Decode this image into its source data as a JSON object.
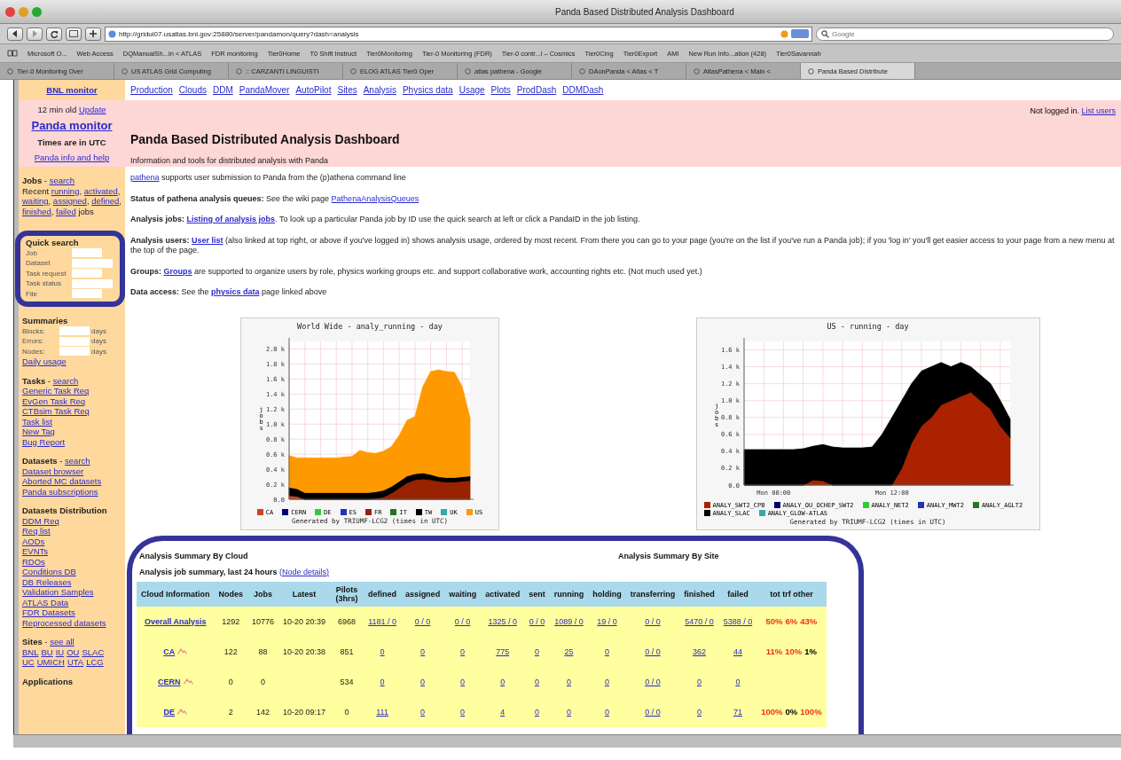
{
  "window": {
    "title": "Panda Based Distributed Analysis Dashboard"
  },
  "toolbar": {
    "url": "http://gridui07.usatlas.bnl.gov:25880/server/pandamon/query?dash=analysis",
    "search_placeholder": "Google"
  },
  "bookmarks": [
    "Microsoft O...",
    "Web Access",
    "DQManualSh...in < ATLAS",
    "FDR monitoring",
    "Tier0Home",
    "T0 Shift Instruct",
    "Tier0Monitoring",
    "Tier-0 Monitoring (FDR)",
    "Tier-0 contr...l – Cosmics",
    "Tier0Cing",
    "Tier0Export",
    "AMI",
    "New Run Info...ation (428)",
    "Tier0Savannah"
  ],
  "tabs": [
    {
      "label": "Tier-0 Monitoring Over",
      "selected": false
    },
    {
      "label": "US ATLAS Grid Computing",
      "selected": false
    },
    {
      "label": ":: CARZANTI LINGUISTI",
      "selected": false
    },
    {
      "label": "ELOG ATLAS Tier0 Oper",
      "selected": false
    },
    {
      "label": "atlas pathena - Google",
      "selected": false
    },
    {
      "label": "DAonPanda < Atlas < T",
      "selected": false
    },
    {
      "label": "AtlasPathena < Main <",
      "selected": false
    },
    {
      "label": "Panda Based Distribute",
      "selected": true
    }
  ],
  "sidebar": {
    "monitor_link": "BNL monitor",
    "banner": [
      [
        {
          "text": "12 min old ",
          "kind": "plain"
        },
        {
          "text": "Update",
          "kind": "link"
        }
      ],
      [
        {
          "text": "Panda monitor",
          "kind": "big-link"
        }
      ],
      [
        {
          "text": "Times are in UTC",
          "kind": "bold"
        }
      ],
      [
        {
          "text": "Panda info and help",
          "kind": "link"
        }
      ]
    ],
    "sections": [
      {
        "kind": "links",
        "lines": [
          [
            {
              "text": "Jobs",
              "kind": "bold"
            },
            {
              "text": " - ",
              "kind": "plain"
            },
            {
              "text": "search",
              "kind": "link"
            }
          ],
          [
            {
              "text": "Recent ",
              "kind": "plain"
            },
            {
              "text": "running",
              "kind": "link"
            },
            {
              "text": ", ",
              "kind": "plain"
            },
            {
              "text": "activated",
              "kind": "link"
            },
            {
              "text": ", ",
              "kind": "plain"
            },
            {
              "text": "waiting",
              "kind": "link"
            },
            {
              "text": ", ",
              "kind": "plain"
            },
            {
              "text": "assigned",
              "kind": "link"
            },
            {
              "text": ", ",
              "kind": "plain"
            },
            {
              "text": "defined",
              "kind": "link"
            },
            {
              "text": ", ",
              "kind": "plain"
            },
            {
              "text": "finished",
              "kind": "link"
            },
            {
              "text": ", ",
              "kind": "plain"
            },
            {
              "text": "failed",
              "kind": "link"
            },
            {
              "text": " jobs",
              "kind": "plain"
            }
          ]
        ]
      },
      {
        "kind": "form",
        "framed": true,
        "heading": "Quick search",
        "fields": [
          {
            "label": "Job"
          },
          {
            "label": "Dataset"
          },
          {
            "label": "Task request"
          },
          {
            "label": "Task status"
          },
          {
            "label": "File"
          }
        ]
      },
      {
        "kind": "form",
        "framed": false,
        "heading": "Summaries",
        "fields": [
          {
            "label": "Blocks:",
            "suffix": "days"
          },
          {
            "label": "Errors:",
            "suffix": "days"
          },
          {
            "label": "Nodes:",
            "suffix": "days"
          }
        ],
        "after": [
          [
            {
              "text": "Daily usage",
              "kind": "link"
            }
          ]
        ]
      },
      {
        "kind": "links",
        "lines": [
          [
            {
              "text": "Tasks",
              "kind": "bold"
            },
            {
              "text": " - ",
              "kind": "plain"
            },
            {
              "text": "search",
              "kind": "link"
            }
          ],
          [
            {
              "text": "Generic Task Req",
              "kind": "link"
            }
          ],
          [
            {
              "text": "EvGen Task Req",
              "kind": "link"
            }
          ],
          [
            {
              "text": "CTBsim Task Req",
              "kind": "link"
            }
          ],
          [
            {
              "text": "Task list",
              "kind": "link"
            }
          ],
          [
            {
              "text": "New Tag",
              "kind": "link"
            }
          ],
          [
            {
              "text": "Bug Report",
              "kind": "link"
            }
          ]
        ]
      },
      {
        "kind": "links",
        "lines": [
          [
            {
              "text": "Datasets",
              "kind": "bold"
            },
            {
              "text": " - ",
              "kind": "plain"
            },
            {
              "text": "search",
              "kind": "link"
            }
          ],
          [
            {
              "text": "Dataset browser",
              "kind": "link"
            }
          ],
          [
            {
              "text": "Aborted MC datasets",
              "kind": "link"
            }
          ],
          [
            {
              "text": "Panda subscriptions",
              "kind": "link"
            }
          ]
        ]
      },
      {
        "kind": "links",
        "lines": [
          [
            {
              "text": "Datasets Distribution",
              "kind": "bold"
            }
          ],
          [
            {
              "text": "DDM Req",
              "kind": "link"
            }
          ],
          [
            {
              "text": "Req list",
              "kind": "link"
            }
          ],
          [
            {
              "text": "AODs",
              "kind": "link"
            }
          ],
          [
            {
              "text": "EVNTs",
              "kind": "link"
            }
          ],
          [
            {
              "text": "RDOs",
              "kind": "link"
            }
          ],
          [
            {
              "text": "Conditions DB",
              "kind": "link"
            }
          ],
          [
            {
              "text": "DB Releases",
              "kind": "link"
            }
          ],
          [
            {
              "text": "Validation Samples",
              "kind": "link"
            }
          ],
          [
            {
              "text": "ATLAS Data",
              "kind": "link"
            }
          ],
          [
            {
              "text": "FDR Datasets",
              "kind": "link"
            }
          ],
          [
            {
              "text": "Reprocessed datasets",
              "kind": "link"
            }
          ]
        ]
      },
      {
        "kind": "links",
        "lines": [
          [
            {
              "text": "Sites",
              "kind": "bold"
            },
            {
              "text": " - ",
              "kind": "plain"
            },
            {
              "text": "see all",
              "kind": "link"
            }
          ],
          [
            {
              "text": "BNL",
              "kind": "link"
            },
            {
              "text": "BU",
              "kind": "link"
            },
            {
              "text": "IU",
              "kind": "link"
            },
            {
              "text": "OU",
              "kind": "link"
            },
            {
              "text": "SLAC",
              "kind": "link"
            }
          ],
          [
            {
              "text": "UC",
              "kind": "link"
            },
            {
              "text": "UMICH",
              "kind": "link"
            },
            {
              "text": "UTA",
              "kind": "link"
            },
            {
              "text": "LCG",
              "kind": "link"
            }
          ]
        ]
      },
      {
        "kind": "links",
        "lines": [
          [
            {
              "text": "Applications",
              "kind": "bold"
            }
          ]
        ]
      }
    ]
  },
  "nav": [
    "Production",
    "Clouds",
    "DDM",
    "PandaMover",
    "AutoPilot",
    "Sites",
    "Analysis",
    "Physics data",
    "Usage",
    "Plots",
    "ProdDash",
    "DDMDash"
  ],
  "header": {
    "login": [
      {
        "text": "Not logged in. ",
        "kind": "plain"
      },
      {
        "text": "List users",
        "kind": "link"
      }
    ],
    "title": "Panda Based Distributed Analysis Dashboard",
    "subtitle": "Information and tools for distributed analysis with Panda"
  },
  "paragraphs": [
    [
      {
        "text": "pathena",
        "kind": "link"
      },
      {
        "text": " supports user submission to Panda from the (p)athena command line",
        "kind": "plain"
      }
    ],
    [
      {
        "text": "Status of pathena analysis queues:",
        "kind": "bold"
      },
      {
        "text": " See the wiki page ",
        "kind": "plain"
      },
      {
        "text": "PathenaAnalysisQueues",
        "kind": "link"
      }
    ],
    [
      {
        "text": "Analysis jobs: ",
        "kind": "bold"
      },
      {
        "text": "Listing of analysis jobs",
        "kind": "bold-link"
      },
      {
        "text": ". To look up a particular Panda job by ID use the quick search at left or click a PandaID in the job listing.",
        "kind": "plain"
      }
    ],
    [
      {
        "text": "Analysis users: ",
        "kind": "bold"
      },
      {
        "text": "User list",
        "kind": "bold-link"
      },
      {
        "text": " (also linked at top right, or above if you've logged in) shows analysis usage, ordered by most recent. From there you can go to your page (you're on the list if you've run a Panda job); if you 'log in' you'll get easier access to your page from a new menu at the top of the page.",
        "kind": "plain"
      }
    ],
    [
      {
        "text": "Groups: ",
        "kind": "bold"
      },
      {
        "text": "Groups",
        "kind": "bold-link"
      },
      {
        "text": " are supported to organize users by role, physics working groups etc. and support collaborative work, accounting rights etc. (Not much used yet.)",
        "kind": "plain"
      }
    ],
    [
      {
        "text": "Data access:",
        "kind": "bold"
      },
      {
        "text": " See the ",
        "kind": "plain"
      },
      {
        "text": "physics data",
        "kind": "bold-link"
      },
      {
        "text": " page linked above",
        "kind": "plain"
      }
    ]
  ],
  "charts": [
    {
      "heading": "Analysis Summary By Cloud",
      "footer": "Generated by TRIUMF-LCG2 (times in UTC)",
      "chart_data": {
        "type": "area",
        "stacked": true,
        "grid": true,
        "legend": "bottom",
        "title": "World Wide - analy_running - day",
        "ylabel": "jobs",
        "ylim": [
          0,
          2100
        ],
        "yticks": [
          {
            "value": 0,
            "label": "0.0"
          },
          {
            "value": 200,
            "label": "0.2 k"
          },
          {
            "value": 400,
            "label": "0.4 k"
          },
          {
            "value": 600,
            "label": "0.6 k"
          },
          {
            "value": 800,
            "label": "0.8 k"
          },
          {
            "value": 1000,
            "label": "1.0 k"
          },
          {
            "value": 1200,
            "label": "1.2 k"
          },
          {
            "value": 1400,
            "label": "1.4 k"
          },
          {
            "value": 1600,
            "label": "1.6 k"
          },
          {
            "value": 1800,
            "label": "1.8 k"
          },
          {
            "value": 2000,
            "label": "2.0 k"
          }
        ],
        "series": [
          {
            "name": "CA",
            "color": "#cc4422",
            "values": [
              50,
              40,
              0,
              0,
              0,
              0,
              0,
              0,
              0,
              0,
              0,
              0,
              0,
              0,
              0,
              0,
              0,
              0,
              0,
              0,
              0,
              0,
              0,
              0
            ]
          },
          {
            "name": "CERN",
            "color": "#000077",
            "values": [
              null,
              null,
              null,
              null,
              null,
              null,
              null,
              null,
              null,
              null,
              null,
              null,
              null,
              null,
              null,
              null,
              null,
              null,
              null,
              null,
              null,
              null,
              null,
              null
            ]
          },
          {
            "name": "DE",
            "color": "#33cc33",
            "values": [
              null,
              null,
              null,
              null,
              null,
              null,
              null,
              null,
              null,
              null,
              null,
              null,
              null,
              null,
              null,
              null,
              null,
              null,
              null,
              null,
              null,
              null,
              null,
              null
            ]
          },
          {
            "name": "ES",
            "color": "#2233bb",
            "values": [
              null,
              null,
              null,
              null,
              null,
              null,
              null,
              null,
              null,
              null,
              null,
              null,
              null,
              null,
              null,
              null,
              null,
              null,
              null,
              null,
              null,
              null,
              null,
              null
            ]
          },
          {
            "name": "FR",
            "color": "#992200",
            "values": [
              0,
              0,
              0,
              0,
              0,
              0,
              0,
              0,
              0,
              0,
              0,
              10,
              30,
              80,
              150,
              220,
              260,
              270,
              260,
              240,
              230,
              230,
              240,
              250
            ]
          },
          {
            "name": "IT",
            "color": "#227722",
            "values": [
              null,
              null,
              null,
              null,
              null,
              null,
              null,
              null,
              null,
              null,
              null,
              null,
              null,
              null,
              null,
              null,
              null,
              null,
              null,
              null,
              null,
              null,
              null,
              null
            ]
          },
          {
            "name": "TW",
            "color": "#000000",
            "values": [
              110,
              100,
              90,
              90,
              90,
              90,
              90,
              90,
              90,
              90,
              90,
              90,
              90,
              90,
              90,
              90,
              80,
              80,
              70,
              60,
              60,
              60,
              60,
              60
            ]
          },
          {
            "name": "UK",
            "color": "#33aaaa",
            "values": [
              null,
              null,
              null,
              null,
              null,
              null,
              null,
              null,
              null,
              null,
              null,
              null,
              null,
              null,
              null,
              null,
              null,
              null,
              null,
              null,
              null,
              null,
              null,
              null
            ]
          },
          {
            "name": "US",
            "color": "#ff9900",
            "values": [
              420,
              410,
              460,
              460,
              460,
              460,
              460,
              470,
              480,
              560,
              530,
              510,
              520,
              530,
              610,
              740,
              760,
              1150,
              1370,
              1420,
              1410,
              1400,
              1200,
              770
            ]
          }
        ]
      }
    },
    {
      "heading": "Analysis Summary By Site",
      "footer": "Generated by TRIUMF-LCG2 (times in UTC)",
      "chart_data": {
        "type": "area",
        "stacked": true,
        "grid": true,
        "legend": "bottom",
        "title": "US - running - day",
        "ylabel": "jobs",
        "ylim": [
          0,
          1700
        ],
        "categories": [
          null,
          null,
          null,
          "Mon 00:00",
          null,
          null,
          null,
          null,
          null,
          null,
          null,
          null,
          null,
          null,
          null,
          "Mon 12:00",
          null,
          null,
          null,
          null,
          null,
          null,
          null,
          null,
          null,
          null,
          null,
          null
        ],
        "yticks": [
          {
            "value": 0,
            "label": "0.0"
          },
          {
            "value": 200,
            "label": "0.2 k"
          },
          {
            "value": 400,
            "label": "0.4 k"
          },
          {
            "value": 600,
            "label": "0.6 k"
          },
          {
            "value": 800,
            "label": "0.8 k"
          },
          {
            "value": 1000,
            "label": "1.0 k"
          },
          {
            "value": 1200,
            "label": "1.2 k"
          },
          {
            "value": 1400,
            "label": "1.4 k"
          },
          {
            "value": 1600,
            "label": "1.6 k"
          }
        ],
        "series": [
          {
            "name": "ANALY_SWT2_CPB",
            "color": "#aa2200",
            "values": [
              0,
              0,
              0,
              0,
              0,
              0,
              0,
              60,
              50,
              0,
              0,
              0,
              0,
              0,
              0,
              0,
              200,
              500,
              700,
              800,
              950,
              1000,
              1050,
              1100,
              1000,
              900,
              700,
              560
            ]
          },
          {
            "name": "ANALY_OU_OCHEP_SWT2",
            "color": "#000066",
            "values": [
              null,
              null,
              null,
              null,
              null,
              null,
              null,
              null,
              null,
              null,
              null,
              null,
              null,
              null,
              null,
              null,
              null,
              null,
              null,
              null,
              null,
              null,
              null,
              null,
              null,
              null,
              null,
              null
            ]
          },
          {
            "name": "ANALY_NET2",
            "color": "#33cc33",
            "values": [
              null,
              null,
              null,
              null,
              null,
              null,
              null,
              null,
              null,
              null,
              null,
              null,
              null,
              null,
              null,
              null,
              null,
              null,
              null,
              null,
              null,
              null,
              null,
              null,
              null,
              null,
              null,
              null
            ]
          },
          {
            "name": "ANALY_MWT2",
            "color": "#2233bb",
            "values": [
              null,
              null,
              null,
              null,
              null,
              null,
              null,
              null,
              null,
              null,
              null,
              null,
              null,
              null,
              null,
              null,
              null,
              null,
              null,
              null,
              null,
              null,
              null,
              null,
              null,
              null,
              null,
              null
            ]
          },
          {
            "name": "ANALY_AGLT2",
            "color": "#227722",
            "values": [
              null,
              null,
              null,
              null,
              null,
              null,
              null,
              null,
              null,
              null,
              null,
              null,
              null,
              null,
              null,
              null,
              null,
              null,
              null,
              null,
              null,
              null,
              null,
              null,
              null,
              null,
              null,
              null
            ]
          },
          {
            "name": "ANALY_SLAC",
            "color": "#000000",
            "values": [
              420,
              420,
              420,
              420,
              420,
              420,
              430,
              400,
              430,
              450,
              440,
              440,
              440,
              450,
              600,
              800,
              800,
              700,
              650,
              600,
              500,
              400,
              400,
              300,
              300,
              300,
              300,
              220
            ]
          },
          {
            "name": "ANALY_GLOW-ATLAS",
            "color": "#33aaaa",
            "values": [
              null,
              null,
              null,
              null,
              null,
              null,
              null,
              null,
              null,
              null,
              null,
              null,
              null,
              null,
              null,
              null,
              null,
              null,
              null,
              null,
              null,
              null,
              null,
              null,
              null,
              null,
              null,
              null
            ]
          }
        ]
      }
    }
  ],
  "summary": {
    "caption": [
      {
        "text": "Analysis job summary, last 24 hours ",
        "kind": "bold"
      },
      {
        "text": "(Node details)",
        "kind": "link"
      }
    ],
    "columns": [
      "Cloud Information",
      "Nodes",
      "Jobs",
      "Latest",
      "Pilots (3hrs)",
      "defined",
      "assigned",
      "waiting",
      "activated",
      "sent",
      "running",
      "holding",
      "transferring",
      "finished",
      "failed",
      "tot trf other"
    ],
    "rows": [
      {
        "cells": [
          {
            "kind": "cloud",
            "text": "Overall Analysis",
            "chart_icon": false
          },
          {
            "kind": "text",
            "text": "1292"
          },
          {
            "kind": "text",
            "text": "10776"
          },
          {
            "kind": "text",
            "text": "10-20 20:39"
          },
          {
            "kind": "text",
            "text": "6968"
          },
          {
            "kind": "link",
            "text": "1181 / 0"
          },
          {
            "kind": "link",
            "text": "0 / 0"
          },
          {
            "kind": "link",
            "text": "0 / 0"
          },
          {
            "kind": "link",
            "text": "1325 / 0"
          },
          {
            "kind": "link",
            "text": "0 / 0"
          },
          {
            "kind": "link",
            "text": "1089 / 0"
          },
          {
            "kind": "link",
            "text": "19 / 0"
          },
          {
            "kind": "link",
            "text": "0 / 0"
          },
          {
            "kind": "link",
            "text": "5470 / 0"
          },
          {
            "kind": "link",
            "text": "5388 / 0"
          },
          {
            "kind": "rates",
            "parts": [
              {
                "text": "50%",
                "color": "#ee3311"
              },
              {
                "text": "6%",
                "color": "#ee3311"
              },
              {
                "text": "43%",
                "color": "#ee3311"
              }
            ]
          }
        ]
      },
      {
        "cells": [
          {
            "kind": "cloud",
            "text": "CA",
            "chart_icon": true
          },
          {
            "kind": "text",
            "text": "122"
          },
          {
            "kind": "text",
            "text": "88"
          },
          {
            "kind": "text",
            "text": "10-20 20:38"
          },
          {
            "kind": "text",
            "text": "851"
          },
          {
            "kind": "link",
            "text": "0"
          },
          {
            "kind": "link",
            "text": "0"
          },
          {
            "kind": "link",
            "text": "0"
          },
          {
            "kind": "link",
            "text": "775"
          },
          {
            "kind": "link",
            "text": "0"
          },
          {
            "kind": "link",
            "text": "25"
          },
          {
            "kind": "link",
            "text": "0"
          },
          {
            "kind": "link",
            "text": "0 / 0"
          },
          {
            "kind": "link",
            "text": "362"
          },
          {
            "kind": "link",
            "text": "44"
          },
          {
            "kind": "rates",
            "parts": [
              {
                "text": "11%",
                "color": "#ee3311"
              },
              {
                "text": "10%",
                "color": "#ee3311"
              },
              {
                "text": "1%",
                "color": "#000000"
              }
            ]
          }
        ]
      },
      {
        "cells": [
          {
            "kind": "cloud",
            "text": "CERN",
            "chart_icon": true
          },
          {
            "kind": "text",
            "text": "0"
          },
          {
            "kind": "text",
            "text": "0"
          },
          null,
          {
            "kind": "text",
            "text": "534"
          },
          {
            "kind": "link",
            "text": "0"
          },
          {
            "kind": "link",
            "text": "0"
          },
          {
            "kind": "link",
            "text": "0"
          },
          {
            "kind": "link",
            "text": "0"
          },
          {
            "kind": "link",
            "text": "0"
          },
          {
            "kind": "link",
            "text": "0"
          },
          {
            "kind": "link",
            "text": "0"
          },
          {
            "kind": "link",
            "text": "0 / 0"
          },
          {
            "kind": "link",
            "text": "0"
          },
          {
            "kind": "link",
            "text": "0"
          },
          null
        ]
      },
      {
        "cells": [
          {
            "kind": "cloud",
            "text": "DE",
            "chart_icon": true
          },
          {
            "kind": "text",
            "text": "2"
          },
          {
            "kind": "text",
            "text": "142"
          },
          {
            "kind": "text",
            "text": "10-20 09:17"
          },
          {
            "kind": "text",
            "text": "0"
          },
          {
            "kind": "link",
            "text": "111"
          },
          {
            "kind": "link",
            "text": "0"
          },
          {
            "kind": "link",
            "text": "0"
          },
          {
            "kind": "link",
            "text": "4"
          },
          {
            "kind": "link",
            "text": "0"
          },
          {
            "kind": "link",
            "text": "0"
          },
          {
            "kind": "link",
            "text": "0"
          },
          {
            "kind": "link",
            "text": "0 / 0"
          },
          {
            "kind": "link",
            "text": "0"
          },
          {
            "kind": "link",
            "text": "71"
          },
          {
            "kind": "rates",
            "parts": [
              {
                "text": "100%",
                "color": "#ee3311"
              },
              {
                "text": "0%",
                "color": "#000000"
              },
              {
                "text": "100%",
                "color": "#ee3311"
              }
            ]
          }
        ]
      }
    ]
  }
}
